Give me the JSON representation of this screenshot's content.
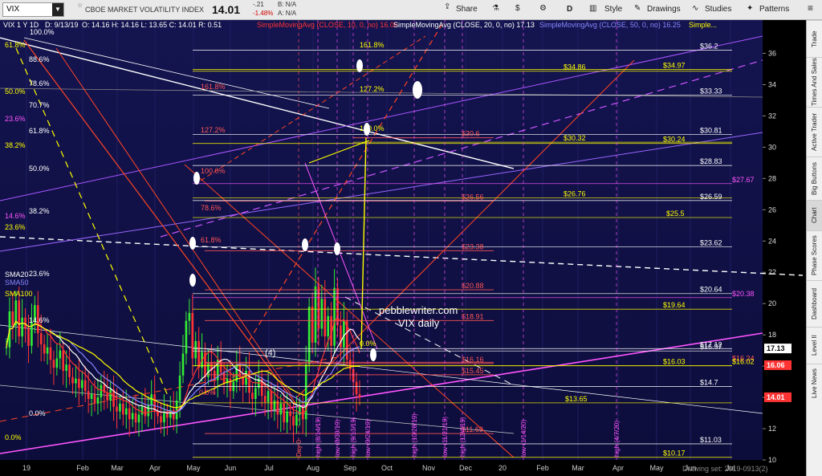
{
  "toolbar": {
    "symbol": "VIX",
    "index_name": "CBOE MARKET VOLATILITY INDEX",
    "price": "14.01",
    "change": "-.21",
    "change_pct": "-1.48%",
    "bid": "B: N/A",
    "ask": "A: N/A",
    "share_label": "Share",
    "period_label": "D",
    "style_label": "Style",
    "drawings_label": "Drawings",
    "studies_label": "Studies",
    "patterns_label": "Patterns"
  },
  "sidebar": {
    "tabs": [
      "Trade",
      "Times And Sales",
      "Active Trader",
      "Big Buttons",
      "Chart",
      "Phase Scores",
      "Dashboard",
      "Level II",
      "Live News"
    ]
  },
  "chart_data": {
    "type": "candlestick",
    "header": {
      "symbol_line": "VIX 1 Y 1D",
      "date": "D: 9/13/19",
      "ohlc": "O: 14.16  H: 14.16  L: 13.65  C: 14.01  R: 0.51",
      "studies": [
        {
          "label": "SimpleMovingAvg (CLOSE, 10, 0, no)",
          "value": "16.06",
          "color": "#ff3333"
        },
        {
          "label": "SimpleMovingAvg (CLOSE, 20, 0, no)",
          "value": "17.13",
          "color": "#ffffff"
        },
        {
          "label": "SimpleMovingAvg (CLOSE, 50, 0, no)",
          "value": "16.25",
          "color": "#8888ff"
        },
        {
          "label": "Simple...",
          "value": "",
          "color": "#ffff00"
        }
      ]
    },
    "y_axis": {
      "min": 10,
      "max": 37,
      "ticks": [
        10,
        12,
        14,
        16,
        18,
        20,
        22,
        24,
        26,
        28,
        30,
        32,
        34,
        36
      ]
    },
    "x_axis": {
      "labels": [
        "19",
        "Feb",
        "Mar",
        "Apr",
        "May",
        "Jun",
        "Jul",
        "Aug",
        "Sep",
        "Oct",
        "Nov",
        "Dec",
        "20",
        "Feb",
        "Mar",
        "Apr",
        "May",
        "Jun",
        "Jul"
      ]
    },
    "price_tags": [
      {
        "value": 17.13,
        "text": "17.13",
        "color": "#ffffff",
        "fg": "#000000"
      },
      {
        "value": 16.06,
        "text": "16.06",
        "color": "#ff3333",
        "fg": "#ffffff"
      },
      {
        "value": 14.01,
        "text": "14.01",
        "color": "#ff3333",
        "fg": "#ffffff"
      }
    ],
    "level_labels": [
      {
        "value": 36.2,
        "text": "$36.2",
        "color": "#ffffff"
      },
      {
        "value": 34.97,
        "text": "$34.97",
        "color": "#ffff00"
      },
      {
        "value": 34.86,
        "text": "$34.86",
        "color": "#ffff00"
      },
      {
        "value": 33.33,
        "text": "$33.33",
        "color": "#ffffff"
      },
      {
        "value": 30.81,
        "text": "$30.81",
        "color": "#ffffff"
      },
      {
        "value": 30.32,
        "text": "$30.32",
        "color": "#ffff00"
      },
      {
        "value": 30.24,
        "text": "$30.24",
        "color": "#ffff00"
      },
      {
        "value": 30.6,
        "text": "$30.6",
        "color": "#ff5555"
      },
      {
        "value": 28.83,
        "text": "$28.83",
        "color": "#ffffff"
      },
      {
        "value": 27.67,
        "text": "$27.67",
        "color": "#ff55ff"
      },
      {
        "value": 26.76,
        "text": "$26.76",
        "color": "#ffff00"
      },
      {
        "value": 26.56,
        "text": "$26.56",
        "color": "#ff5555"
      },
      {
        "value": 26.59,
        "text": "$26.59",
        "color": "#ffffff"
      },
      {
        "value": 25.5,
        "text": "$25.5",
        "color": "#ffff00"
      },
      {
        "value": 23.62,
        "text": "$23.62",
        "color": "#ffffff"
      },
      {
        "value": 23.38,
        "text": "$23.38",
        "color": "#ff5555"
      },
      {
        "value": 20.88,
        "text": "$20.88",
        "color": "#ff5555"
      },
      {
        "value": 20.64,
        "text": "$20.64",
        "color": "#ffffff"
      },
      {
        "value": 20.38,
        "text": "$20.38",
        "color": "#ff55ff"
      },
      {
        "value": 19.64,
        "text": "$19.64",
        "color": "#ffff00"
      },
      {
        "value": 18.91,
        "text": "$18.91",
        "color": "#ff5555"
      },
      {
        "value": 17.12,
        "text": "$17.12",
        "color": "#ffffff"
      },
      {
        "value": 16.97,
        "text": "$16.97",
        "color": "#ffffff"
      },
      {
        "value": 16.24,
        "text": "$16.24",
        "color": "#ff5555"
      },
      {
        "value": 16.16,
        "text": "$16.16",
        "color": "#ff5555"
      },
      {
        "value": 16.03,
        "text": "$16.03",
        "color": "#ffff00"
      },
      {
        "value": 16.02,
        "text": "$16.02",
        "color": "#ffff00"
      },
      {
        "value": 15.45,
        "text": "$15.45",
        "color": "#ff5555"
      },
      {
        "value": 14.7,
        "text": "$14.7",
        "color": "#ffffff"
      },
      {
        "value": 13.65,
        "text": "$13.65",
        "color": "#ffff00"
      },
      {
        "value": 11.69,
        "text": "$11.69",
        "color": "#ff5555"
      },
      {
        "value": 11.03,
        "text": "$11.03",
        "color": "#ffffff"
      },
      {
        "value": 10.17,
        "text": "$10.17",
        "color": "#ffff00"
      }
    ],
    "fib_labels": [
      {
        "text": "100.0%",
        "color": "#ffffff"
      },
      {
        "text": "61.8%",
        "color": "#ffff00"
      },
      {
        "text": "88.6%",
        "color": "#ffffff"
      },
      {
        "text": "78.6%",
        "color": "#ffffff"
      },
      {
        "text": "50.0%",
        "color": "#ffff00"
      },
      {
        "text": "70.7%",
        "color": "#ffffff"
      },
      {
        "text": "23.6%",
        "color": "#ff55ff"
      },
      {
        "text": "61.8%",
        "color": "#ffffff"
      },
      {
        "text": "38.2%",
        "color": "#ffff00"
      },
      {
        "text": "50.0%",
        "color": "#ffffff"
      },
      {
        "text": "38.2%",
        "color": "#ffffff"
      },
      {
        "text": "14.6%",
        "color": "#ff55ff"
      },
      {
        "text": "23.6%",
        "color": "#ffff00"
      },
      {
        "text": "23.6%",
        "color": "#ffffff"
      },
      {
        "text": "14.6%",
        "color": "#ffffff"
      },
      {
        "text": "0.0%",
        "color": "#ffffff"
      },
      {
        "text": "0.0%",
        "color": "#ffff00"
      },
      {
        "text": "161.8%",
        "color": "#ffff00"
      },
      {
        "text": "127.2%",
        "color": "#ffff00"
      },
      {
        "text": "100.0%",
        "color": "#ffff00"
      },
      {
        "text": "161.8%",
        "color": "#ff5555"
      },
      {
        "text": "127.2%",
        "color": "#ff5555"
      },
      {
        "text": "100.0%",
        "color": "#ff5555"
      },
      {
        "text": "78.6%",
        "color": "#ff5555"
      },
      {
        "text": "61.8%",
        "color": "#ff5555"
      },
      {
        "text": "0.0%",
        "color": "#ff5555"
      },
      {
        "text": "0.0%",
        "color": "#ffff00"
      }
    ],
    "sma_labels": [
      "SMA20",
      "SMA50",
      "SMA100"
    ],
    "annotations": [
      {
        "text": "pebblewriter.com",
        "color": "#ffffff"
      },
      {
        "text": "VIX daily",
        "color": "#ffffff"
      },
      {
        "text": "(4)",
        "color": "#ffffff"
      }
    ],
    "vertical_markers": [
      {
        "text": "Day 0",
        "color": "#ff5555"
      },
      {
        "text": "high (8/14/19)",
        "color": "#ff55ff"
      },
      {
        "text": "low (8/30/19)",
        "color": "#ff55ff"
      },
      {
        "text": "high (9/13/19)",
        "color": "#ff55ff"
      },
      {
        "text": "low (9/24/19)",
        "color": "#ff55ff"
      },
      {
        "text": "high (10/28/19)",
        "color": "#ff55ff"
      },
      {
        "text": "low (11/21/19)",
        "color": "#ff55ff"
      },
      {
        "text": "high (12/4/19)",
        "color": "#ff55ff"
      },
      {
        "text": "low (1/14/20)",
        "color": "#ff55ff"
      },
      {
        "text": "high (4/7/20)",
        "color": "#ff55ff"
      }
    ],
    "drawing_set": "Drawing set: 2019-0913(2)",
    "closes": [
      17.2,
      19.5,
      18.6,
      20.2,
      17.9,
      19.1,
      18.4,
      17.3,
      18.8,
      19.9,
      18.1,
      17.4,
      16.8,
      17.2,
      16.4,
      15.9,
      16.5,
      17.0,
      15.7,
      16.1,
      15.3,
      14.9,
      15.2,
      14.6,
      15.1,
      14.4,
      13.9,
      14.2,
      13.6,
      14.0,
      14.8,
      14.3,
      13.8,
      14.5,
      13.4,
      13.1,
      13.6,
      12.9,
      13.3,
      12.6,
      13.0,
      12.4,
      12.9,
      13.4,
      12.8,
      13.5,
      14.2,
      13.1,
      12.8,
      12.4,
      13.0,
      12.7,
      13.2,
      12.6,
      13.8,
      15.4,
      16.8,
      18.9,
      19.4,
      16.5,
      17.6,
      15.9,
      16.9,
      15.3,
      16.2,
      15.7,
      15.1,
      16.4,
      15.6,
      14.9,
      15.2,
      14.4,
      15.0,
      16.1,
      15.3,
      14.8,
      15.7,
      14.3,
      13.9,
      14.6,
      15.2,
      14.1,
      13.7,
      14.4,
      13.2,
      13.8,
      12.9,
      13.6,
      12.4,
      13.1,
      12.8,
      12.2,
      12.9,
      13.4,
      12.6,
      16.1,
      19.8,
      17.5,
      21.1,
      18.4,
      20.3,
      17.9,
      19.2,
      17.3,
      21.0,
      18.6,
      17.2,
      18.9,
      16.4,
      15.8,
      15.0,
      14.2,
      14.0
    ]
  }
}
